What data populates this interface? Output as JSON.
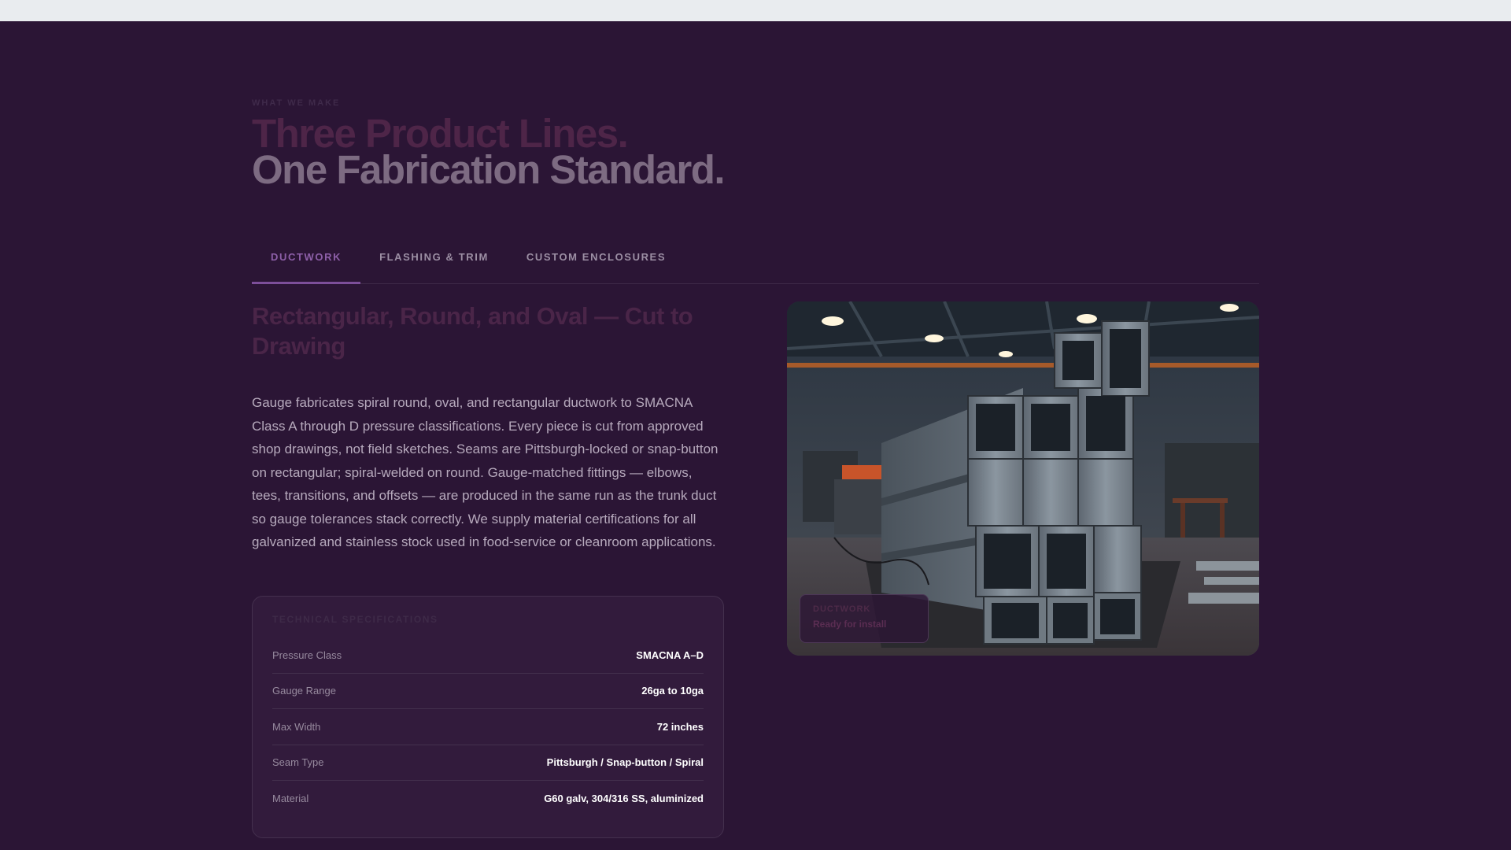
{
  "section": {
    "eyebrow": "WHAT WE MAKE",
    "title_line1": "Three Product Lines.",
    "title_line2": "One Fabrication Standard."
  },
  "tabs": [
    {
      "label": "DUCTWORK",
      "active": true
    },
    {
      "label": "FLASHING & TRIM",
      "active": false
    },
    {
      "label": "CUSTOM ENCLOSURES",
      "active": false
    }
  ],
  "ductwork": {
    "subhead": "Rectangular, Round, and Oval — Cut to Drawing",
    "body": "Gauge fabricates spiral round, oval, and rectangular ductwork to SMACNA Class A through D pressure classifications. Every piece is cut from approved shop drawings, not field sketches. Seams are Pittsburgh-locked or snap-button on rectangular; spiral-welded on round. Gauge-matched fittings — elbows, tees, transitions, and offsets — are produced in the same run as the trunk duct so gauge tolerances stack correctly. We supply material certifications for all galvanized and stainless stock used in food-service or cleanroom applications.",
    "specs": {
      "title": "TECHNICAL SPECIFICATIONS",
      "rows": [
        {
          "label": "Pressure Class",
          "value": "SMACNA A–D"
        },
        {
          "label": "Gauge Range",
          "value": "26ga to 10ga"
        },
        {
          "label": "Max Width",
          "value": "72 inches"
        },
        {
          "label": "Seam Type",
          "value": "Pittsburgh / Snap-button / Spiral"
        },
        {
          "label": "Material",
          "value": "G60 galv, 304/316 SS, aluminized"
        }
      ]
    },
    "image_badge": {
      "label": "DUCTWORK",
      "text": "Ready for install"
    }
  },
  "colors": {
    "background": "#2b1535",
    "accent": "#7d4f9a",
    "card": "#321b3c"
  }
}
